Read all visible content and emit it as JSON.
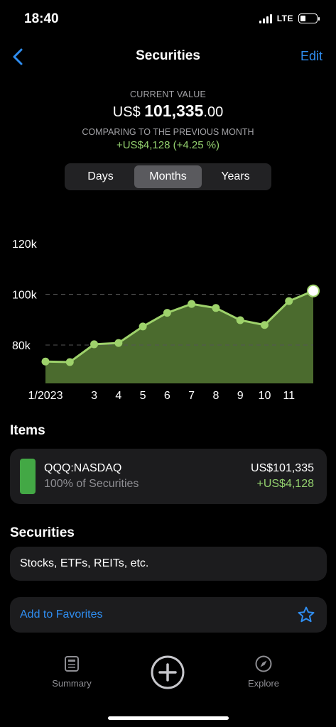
{
  "status_bar": {
    "time": "18:40",
    "network": "LTE"
  },
  "nav": {
    "title": "Securities",
    "edit_label": "Edit"
  },
  "summary": {
    "current_value_label": "CURRENT VALUE",
    "currency": "US$",
    "value_int": "101,335",
    "value_dec": ".00",
    "comparing_label": "COMPARING TO THE PREVIOUS MONTH",
    "change": "+US$4,128 (+4.25 %)"
  },
  "segments": [
    "Days",
    "Months",
    "Years"
  ],
  "selected_segment": "Months",
  "chart_data": {
    "type": "area",
    "title": "",
    "y_ticks": [
      "120k",
      "100k",
      "80k"
    ],
    "x_tick_labels": [
      "1/2023",
      "3",
      "4",
      "5",
      "6",
      "7",
      "8",
      "9",
      "10",
      "11"
    ],
    "ylim": [
      80000,
      120000
    ],
    "x": [
      1,
      2,
      3,
      4,
      5,
      6,
      7,
      8,
      9,
      10,
      11,
      12
    ],
    "values": [
      73500,
      73300,
      80300,
      80800,
      87300,
      92700,
      96200,
      94600,
      89800,
      87900,
      97300,
      101335
    ],
    "grid_lines": [
      100000,
      80000
    ],
    "colors": {
      "line": "#9ed26b",
      "fill": "#4b6b2e",
      "grid": "#555555"
    }
  },
  "items_section": {
    "title": "Items",
    "items": [
      {
        "name": "QQQ:NASDAQ",
        "share": "100% of Securities",
        "value": "US$101,335",
        "change": "+US$4,128",
        "color": "#43a845"
      }
    ]
  },
  "securities_section": {
    "title": "Securities",
    "description": "Stocks, ETFs, REITs, etc."
  },
  "favorites": {
    "label": "Add to Favorites",
    "icon": "star-icon"
  },
  "tabbar": {
    "summary_label": "Summary",
    "explore_label": "Explore",
    "add_icon": "plus-circle-icon"
  },
  "accent_color": "#2f8df0"
}
